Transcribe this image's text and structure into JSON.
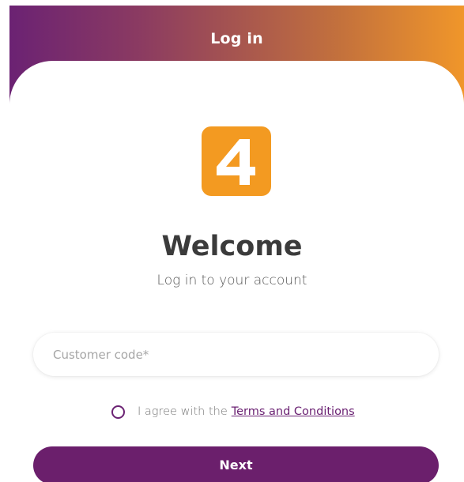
{
  "header": {
    "title": "Log in"
  },
  "logo": {
    "text": "4",
    "icon": "brand-logo-4"
  },
  "main": {
    "welcome": "Welcome",
    "subtitle": "Log in to your account"
  },
  "form": {
    "customer_code_placeholder": "Customer code*",
    "customer_code_value": "",
    "agree_text": "I agree with the",
    "terms_link": "Terms and Conditions",
    "agree_checked": false,
    "next_label": "Next"
  },
  "colors": {
    "gradient_start": "#6b2273",
    "gradient_end": "#f0962a",
    "brand_orange": "#f39a21",
    "brand_purple": "#6b1f6c"
  }
}
